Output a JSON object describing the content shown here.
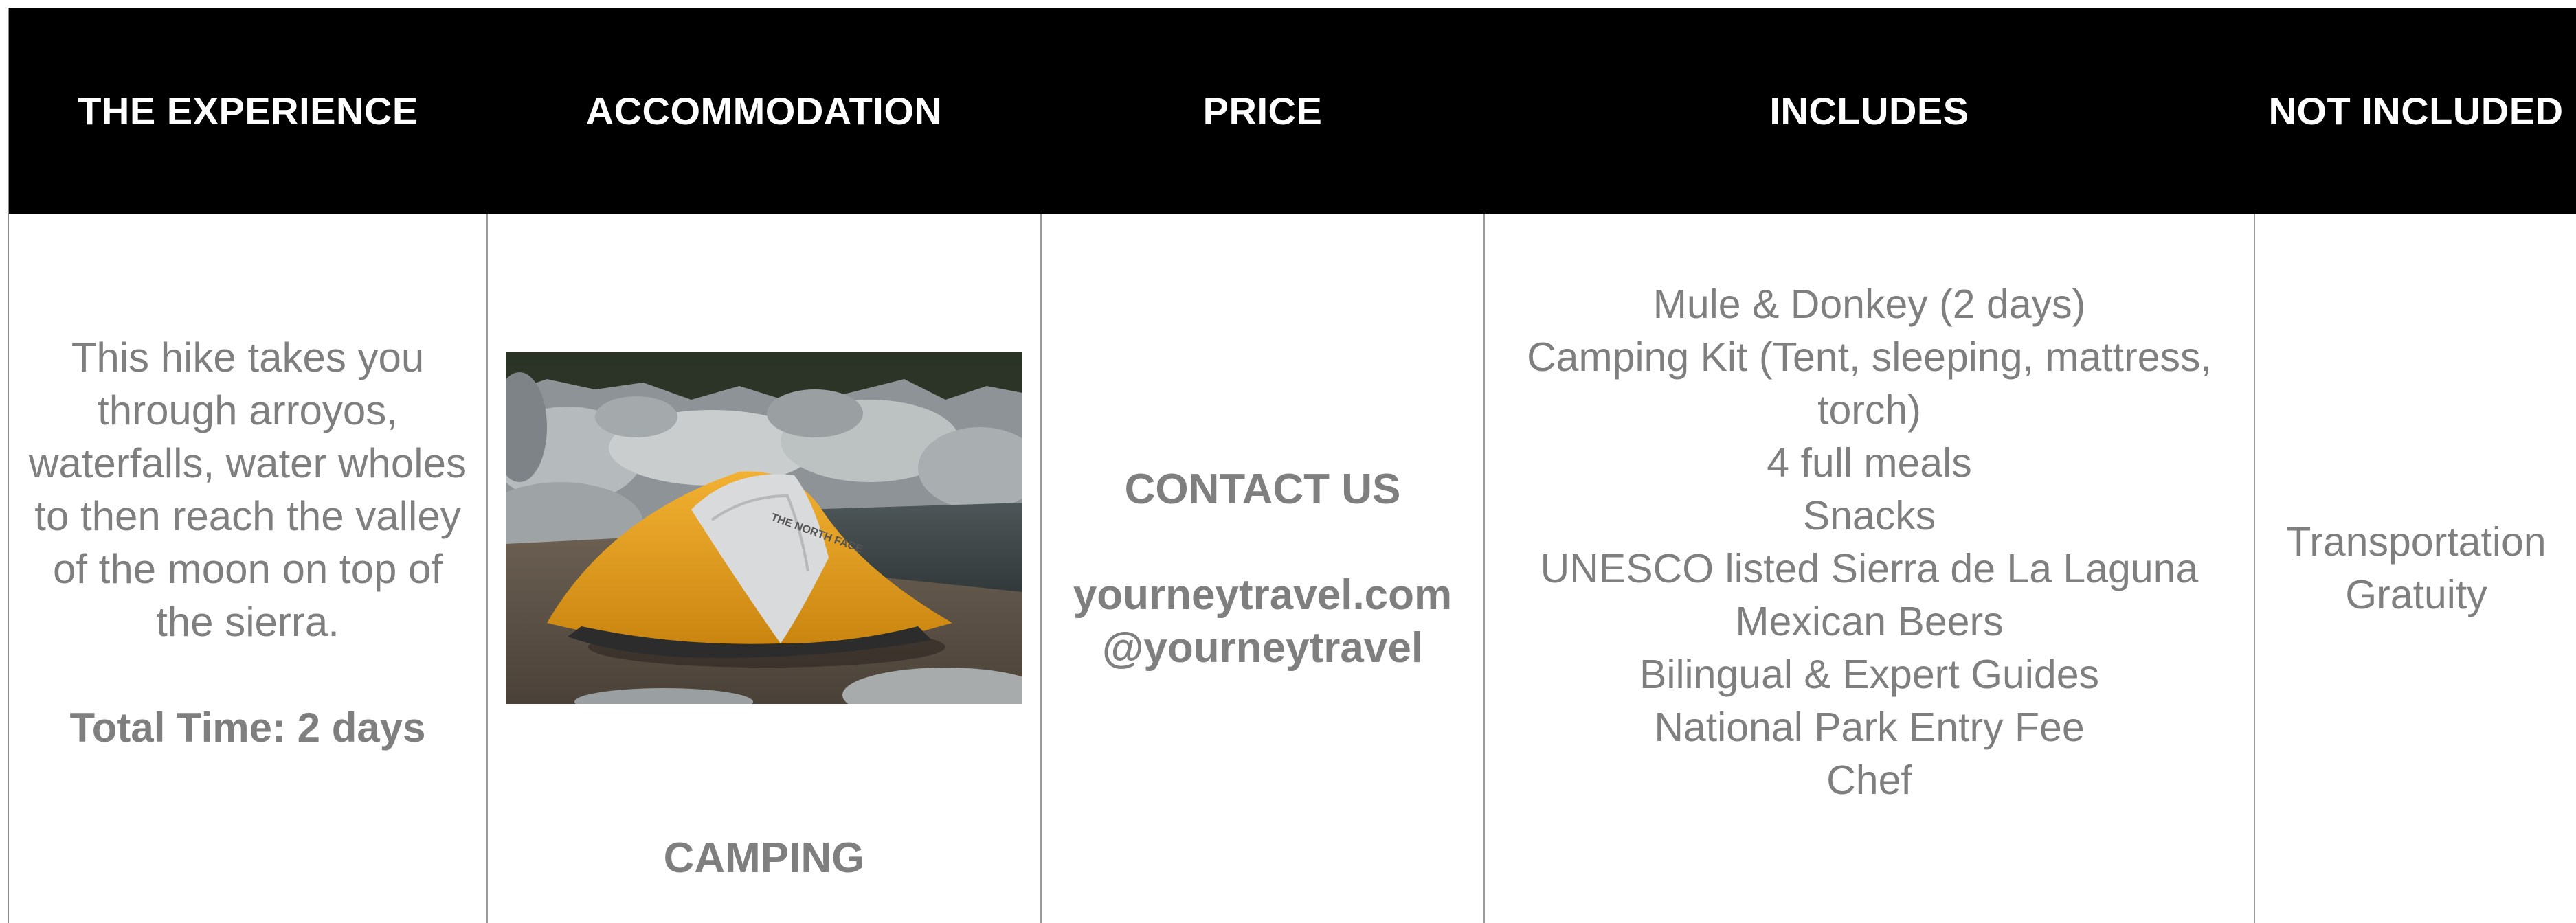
{
  "headers": {
    "experience": "THE EXPERIENCE",
    "accommodation": "ACCOMMODATION",
    "price": "PRICE",
    "includes": "INCLUDES",
    "not_included": "NOT INCLUDED"
  },
  "experience": {
    "description": "This hike takes you through arroyos, waterfalls, water wholes to then reach the valley of the moon on top of the sierra.",
    "total_time": "Total Time: 2 days"
  },
  "accommodation": {
    "photo_caption_logo": "THE NORTH FACE",
    "label": "CAMPING"
  },
  "price": {
    "contact": "CONTACT US",
    "website": "yourneytravel.com",
    "handle": "@yourneytravel"
  },
  "includes": [
    "Mule & Donkey (2 days)",
    "Camping Kit (Tent, sleeping, mattress, torch)",
    "4 full meals",
    "Snacks",
    "UNESCO listed Sierra de La Laguna",
    "Mexican Beers",
    "Bilingual & Expert Guides",
    "National Park Entry Fee",
    "Chef"
  ],
  "not_included": [
    "Transportation",
    "Gratuity"
  ],
  "colors": {
    "header_bg": "#000000",
    "header_text": "#ffffff",
    "body_text": "#7f7f7f",
    "tent_orange": "#e8a21c"
  }
}
